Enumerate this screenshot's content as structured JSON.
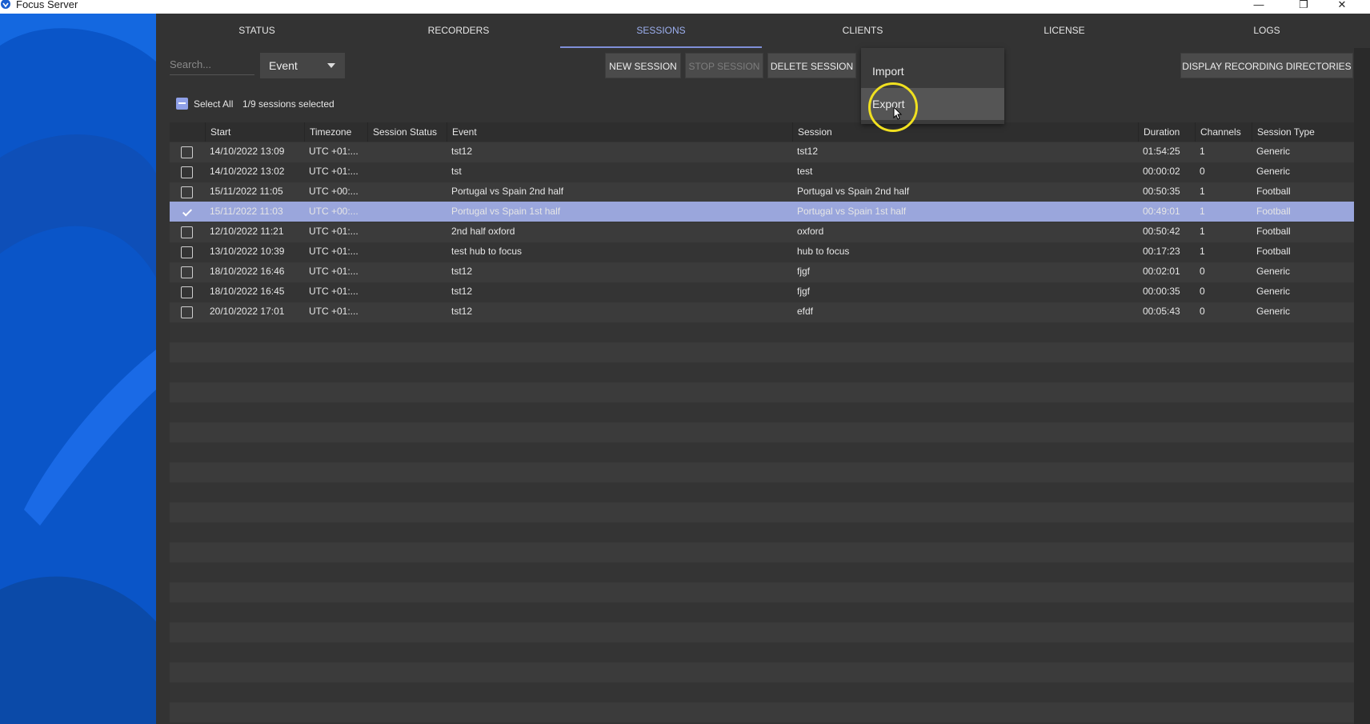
{
  "window": {
    "title": "Focus Server",
    "controls": {
      "minimize": "—",
      "maximize": "❐",
      "close": "✕"
    }
  },
  "tabs": [
    {
      "label": "STATUS"
    },
    {
      "label": "RECORDERS"
    },
    {
      "label": "SESSIONS",
      "active": true
    },
    {
      "label": "CLIENTS"
    },
    {
      "label": "LICENSE"
    },
    {
      "label": "LOGS"
    }
  ],
  "toolbar": {
    "search_placeholder": "Search...",
    "filter_value": "Event",
    "new_session": "NEW SESSION",
    "stop_session": "STOP SESSION",
    "delete_session": "DELETE SESSION",
    "display_dirs": "DISPLAY RECORDING DIRECTORIES"
  },
  "menu": {
    "items": [
      "Import",
      "Export"
    ],
    "hovered": "Export"
  },
  "selection": {
    "select_all_label": "Select All",
    "count_text": "1/9 sessions selected"
  },
  "table": {
    "columns": [
      "Start",
      "Timezone",
      "Session Status",
      "Event",
      "Session",
      "Duration",
      "Channels",
      "Session Type"
    ],
    "rows": [
      {
        "checked": false,
        "start": "14/10/2022 13:09",
        "tz": "UTC +01:...",
        "status": "",
        "event": "tst12",
        "session": "tst12",
        "duration": "01:54:25",
        "channels": "1",
        "type": "Generic"
      },
      {
        "checked": false,
        "start": "14/10/2022 13:02",
        "tz": "UTC +01:...",
        "status": "",
        "event": "tst",
        "session": "test",
        "duration": "00:00:02",
        "channels": "0",
        "type": "Generic"
      },
      {
        "checked": false,
        "start": "15/11/2022 11:05",
        "tz": "UTC +00:...",
        "status": "",
        "event": "Portugal vs Spain 2nd half",
        "session": "Portugal vs Spain 2nd half",
        "duration": "00:50:35",
        "channels": "1",
        "type": "Football"
      },
      {
        "checked": true,
        "start": "15/11/2022 11:03",
        "tz": "UTC +00:...",
        "status": "",
        "event": "Portugal vs Spain 1st half",
        "session": "Portugal vs Spain 1st half",
        "duration": "00:49:01",
        "channels": "1",
        "type": "Football"
      },
      {
        "checked": false,
        "start": "12/10/2022 11:21",
        "tz": "UTC +01:...",
        "status": "",
        "event": "2nd half oxford",
        "session": "oxford",
        "duration": "00:50:42",
        "channels": "1",
        "type": "Football"
      },
      {
        "checked": false,
        "start": "13/10/2022 10:39",
        "tz": "UTC +01:...",
        "status": "",
        "event": "test hub to focus",
        "session": "hub to focus",
        "duration": "00:17:23",
        "channels": "1",
        "type": "Football"
      },
      {
        "checked": false,
        "start": "18/10/2022 16:46",
        "tz": "UTC +01:...",
        "status": "",
        "event": "tst12",
        "session": "fjgf",
        "duration": "00:02:01",
        "channels": "0",
        "type": "Generic"
      },
      {
        "checked": false,
        "start": "18/10/2022 16:45",
        "tz": "UTC +01:...",
        "status": "",
        "event": "tst12",
        "session": "fjgf",
        "duration": "00:00:35",
        "channels": "0",
        "type": "Generic"
      },
      {
        "checked": false,
        "start": "20/10/2022 17:01",
        "tz": "UTC +01:...",
        "status": "",
        "event": "tst12",
        "session": "efdf",
        "duration": "00:05:43",
        "channels": "0",
        "type": "Generic"
      }
    ]
  },
  "colors": {
    "accent": "#9db0f0",
    "selected_row": "#9aa6dc",
    "side_panel": "#0a55c8",
    "cursor_highlight": "#f0e020"
  }
}
